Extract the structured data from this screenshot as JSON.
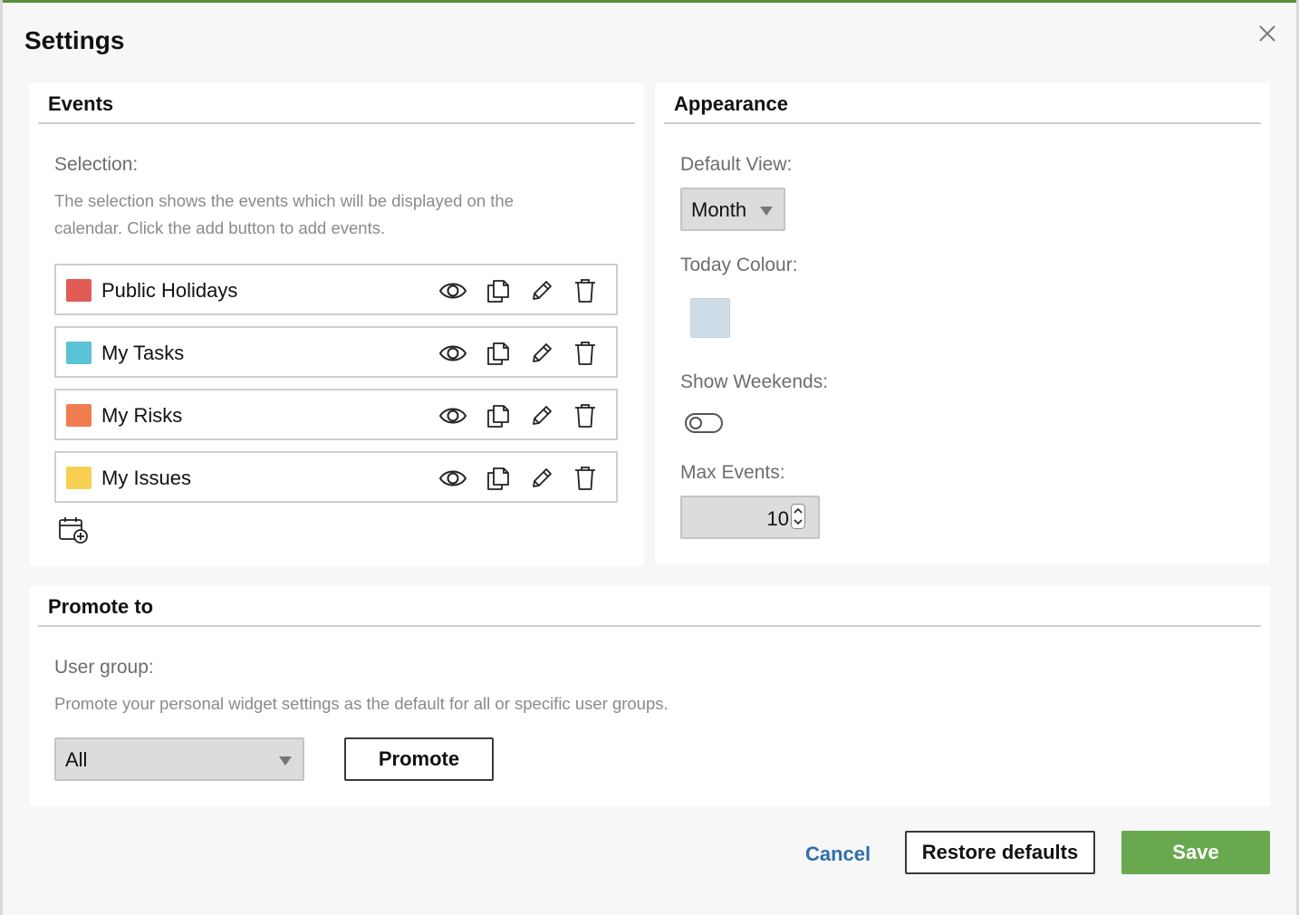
{
  "dialog": {
    "title": "Settings",
    "close_icon": "close-icon"
  },
  "events_section": {
    "heading": "Events",
    "selection_label": "Selection:",
    "help_line1": "The selection shows the events which will be displayed on the",
    "help_line2": "calendar. Click the add button to add events.",
    "items": [
      {
        "name": "Public Holidays",
        "color": "#e05c55"
      },
      {
        "name": "My Tasks",
        "color": "#5bc3d6"
      },
      {
        "name": "My Risks",
        "color": "#ef7d4f"
      },
      {
        "name": "My Issues",
        "color": "#f7cf55"
      }
    ],
    "row_icons": [
      "eye-icon",
      "copy-icon",
      "pencil-icon",
      "trash-icon"
    ],
    "add_icon": "calendar-add-icon"
  },
  "appearance_section": {
    "heading": "Appearance",
    "default_view_label": "Default View:",
    "default_view_value": "Month",
    "today_colour_label": "Today Colour:",
    "today_colour_value": "#cfdde8",
    "show_weekends_label": "Show Weekends:",
    "show_weekends_value": false,
    "max_events_label": "Max Events:",
    "max_events_value": "10"
  },
  "promote_section": {
    "heading": "Promote to",
    "user_group_label": "User group:",
    "help": "Promote your personal widget settings as the default for all or specific user groups.",
    "user_group_value": "All",
    "promote_button": "Promote"
  },
  "footer": {
    "cancel": "Cancel",
    "restore": "Restore defaults",
    "save": "Save"
  }
}
